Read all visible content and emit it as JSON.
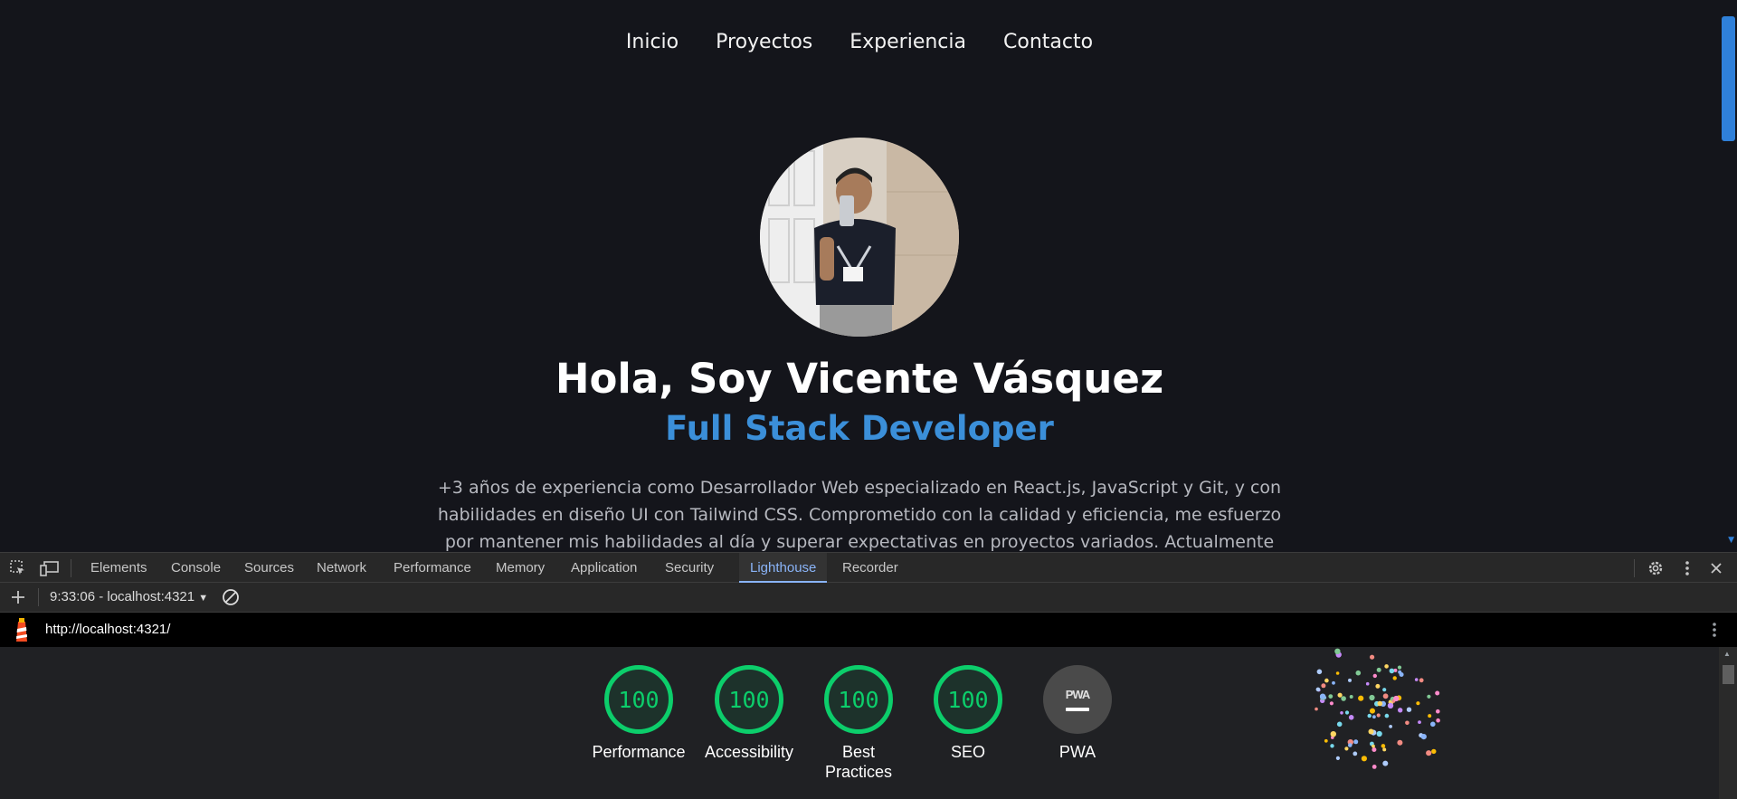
{
  "page": {
    "nav": [
      "Inicio",
      "Proyectos",
      "Experiencia",
      "Contacto"
    ],
    "hero_title": "Hola, Soy Vicente Vásquez",
    "hero_subtitle": "Full Stack Developer",
    "hero_description": "+3 años de experiencia como Desarrollador Web especializado en React.js, JavaScript y Git, y con habilidades en diseño UI con Tailwind CSS. Comprometido con la calidad y eficiencia, me esfuerzo por mantener mis habilidades al día y superar expectativas en proyectos variados. Actualmente me encuentro"
  },
  "devtools": {
    "tabs": [
      "Elements",
      "Console",
      "Sources",
      "Network",
      "Performance",
      "Memory",
      "Application",
      "Security",
      "Lighthouse",
      "Recorder"
    ],
    "active_tab": "Lighthouse",
    "report_selector": "9:33:06 - localhost:4321",
    "url": "http://localhost:4321/",
    "scores": [
      {
        "label": "Performance",
        "score": "100"
      },
      {
        "label": "Accessibility",
        "score": "100"
      },
      {
        "label": "Best Practices",
        "score": "100"
      },
      {
        "label": "SEO",
        "score": "100"
      }
    ],
    "pwa": {
      "label": "PWA",
      "badge": "PWA"
    },
    "colors": {
      "pass": "#0cce6b",
      "accent": "#8ab4f8",
      "subtitle": "#3b8fd9"
    }
  }
}
